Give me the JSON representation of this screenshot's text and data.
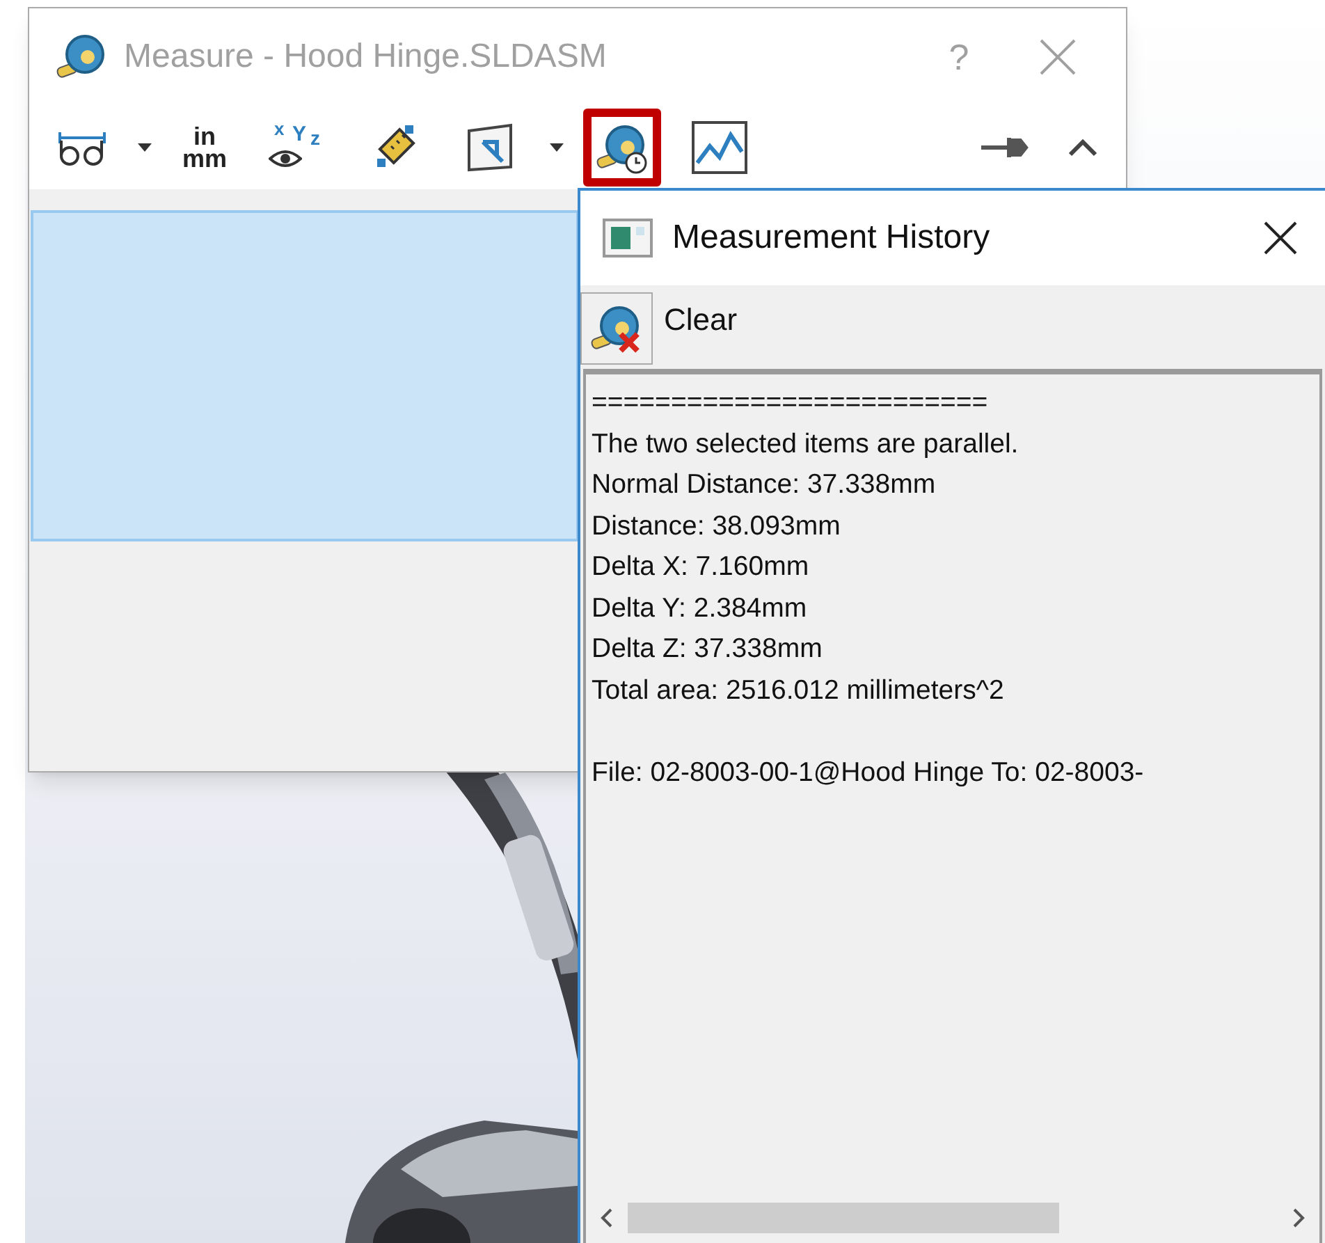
{
  "measure_window": {
    "title": "Measure - Hood Hinge.SLDASM",
    "title_buttons": [
      {
        "kind": "help",
        "label": "?"
      },
      {
        "kind": "close"
      }
    ],
    "toolbar": [
      {
        "kind": "arc",
        "dropdown": true,
        "highlighted": false
      },
      {
        "kind": "units",
        "labels": [
          "in",
          "mm"
        ],
        "dropdown": false,
        "highlighted": false
      },
      {
        "kind": "xyz",
        "labels": [
          "x",
          "Y",
          "z"
        ],
        "dropdown": false,
        "highlighted": false
      },
      {
        "kind": "point",
        "dropdown": false,
        "highlighted": false
      },
      {
        "kind": "projection",
        "dropdown": true,
        "highlighted": false
      },
      {
        "kind": "history",
        "dropdown": false,
        "highlighted": true
      },
      {
        "kind": "sensor",
        "dropdown": false,
        "highlighted": false
      }
    ],
    "toolbar_right": [
      {
        "kind": "pin"
      },
      {
        "kind": "collapse"
      }
    ]
  },
  "history_panel": {
    "title": "Measurement History",
    "clear_button": "Clear",
    "lines": [
      "=========================",
      "The two selected items are parallel.",
      "Normal Distance: 37.338mm",
      "Distance: 38.093mm",
      "Delta X: 7.160mm",
      "Delta Y: 2.384mm",
      "Delta Z: 37.338mm",
      "Total area: 2516.012 millimeters^2"
    ],
    "file_lines": [
      "File: 02-8003-00-1@Hood Hinge To: 02-8003-"
    ]
  }
}
